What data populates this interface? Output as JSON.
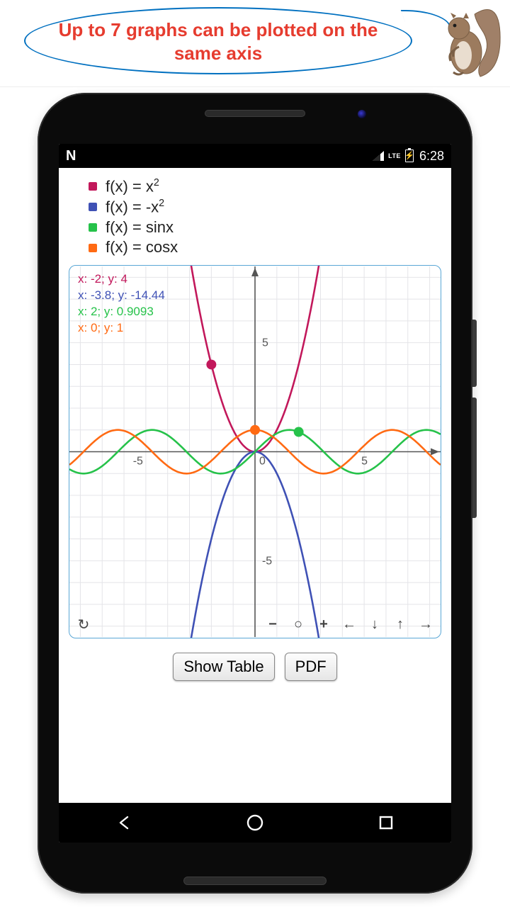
{
  "banner": {
    "text": "Up to 7 graphs can be plotted on the same axis"
  },
  "status": {
    "network": "LTE",
    "time": "6:28"
  },
  "legend": {
    "items": [
      {
        "color": "#c2185b",
        "label_html": "f(x) = x²",
        "label": "f(x) = x^2"
      },
      {
        "color": "#3f51b5",
        "label_html": "f(x) = -x²",
        "label": "f(x) = -x^2"
      },
      {
        "color": "#26c24a",
        "label_html": "f(x) = sinx",
        "label": "f(x) = sinx"
      },
      {
        "color": "#ff6a13",
        "label_html": "f(x) = cosx",
        "label": "f(x) = cosx"
      }
    ]
  },
  "cursor": [
    {
      "color": "#c2185b",
      "text": "x: -2; y: 4"
    },
    {
      "color": "#3f51b5",
      "text": "x: -3.8; y: -14.44"
    },
    {
      "color": "#26c24a",
      "text": "x: 2; y: 0.9093"
    },
    {
      "color": "#ff6a13",
      "text": "x: 0; y: 1"
    }
  ],
  "axes": {
    "x_ticks": [
      -5,
      0,
      5
    ],
    "y_ticks": [
      -5,
      5
    ]
  },
  "buttons": {
    "show_table": "Show Table",
    "pdf": "PDF"
  },
  "chart_data": {
    "type": "line",
    "title": "",
    "xlabel": "",
    "ylabel": "",
    "xlim": [
      -8.5,
      8.5
    ],
    "ylim": [
      -8.5,
      8.5
    ],
    "x_ticks": [
      -5,
      0,
      5
    ],
    "y_ticks": [
      -5,
      5
    ],
    "marked_points": [
      {
        "series": "x^2",
        "x": -2,
        "y": 4
      },
      {
        "series": "-x^2",
        "x": -3.8,
        "y": -14.44
      },
      {
        "series": "sinx",
        "x": 2,
        "y": 0.9093
      },
      {
        "series": "cosx",
        "x": 0,
        "y": 1
      }
    ],
    "series": [
      {
        "name": "f(x) = x^2",
        "color": "#c2185b",
        "formula": "y = x^2"
      },
      {
        "name": "f(x) = -x^2",
        "color": "#3f51b5",
        "formula": "y = -x^2"
      },
      {
        "name": "f(x) = sinx",
        "color": "#26c24a",
        "formula": "y = sin(x)"
      },
      {
        "name": "f(x) = cosx",
        "color": "#ff6a13",
        "formula": "y = cos(x)"
      }
    ],
    "legend_position": "above"
  }
}
